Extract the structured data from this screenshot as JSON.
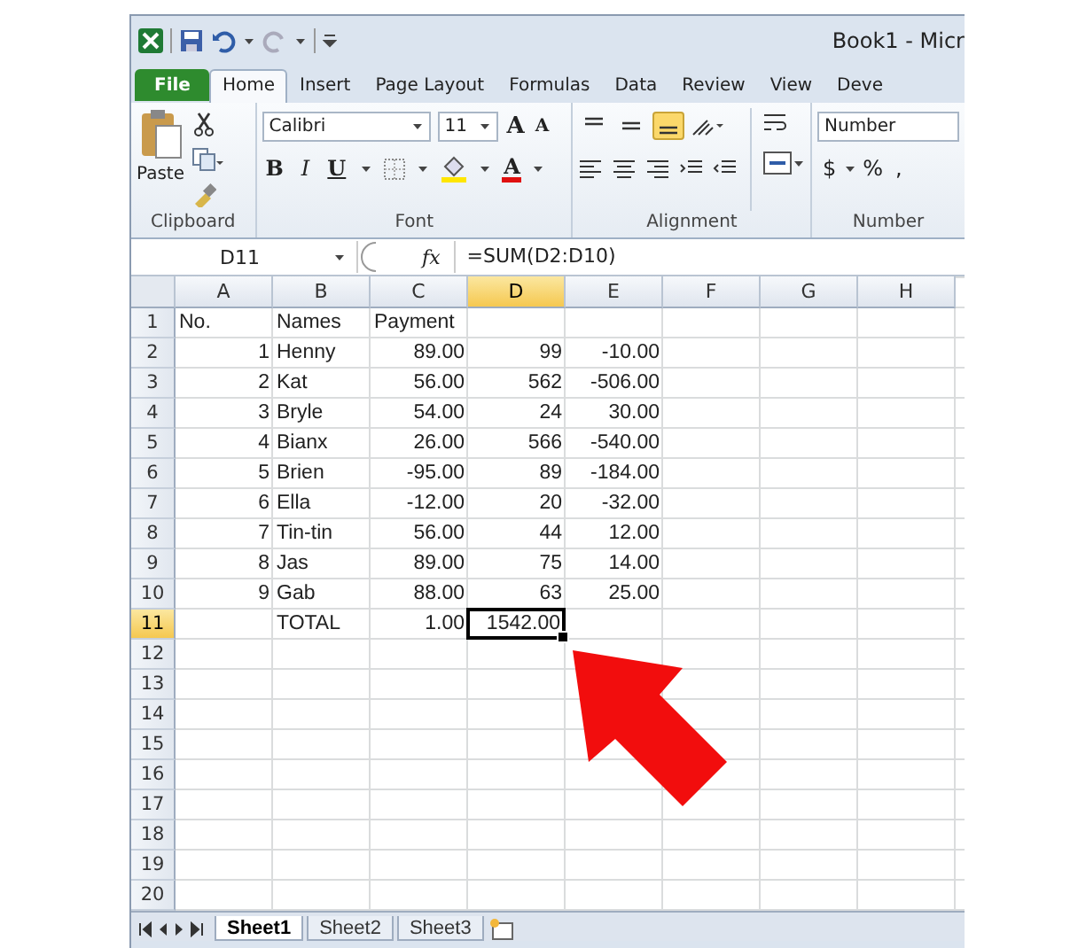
{
  "window": {
    "title": "Book1 - Micr"
  },
  "ribbon_tabs": [
    {
      "label": "File",
      "kind": "file",
      "selected": false
    },
    {
      "label": "Home",
      "kind": "tab",
      "selected": true
    },
    {
      "label": "Insert",
      "kind": "tab",
      "selected": false
    },
    {
      "label": "Page Layout",
      "kind": "tab",
      "selected": false
    },
    {
      "label": "Formulas",
      "kind": "tab",
      "selected": false
    },
    {
      "label": "Data",
      "kind": "tab",
      "selected": false
    },
    {
      "label": "Review",
      "kind": "tab",
      "selected": false
    },
    {
      "label": "View",
      "kind": "tab",
      "selected": false
    },
    {
      "label": "Deve",
      "kind": "tab",
      "selected": false
    }
  ],
  "clipboard": {
    "paste_label": "Paste",
    "group_label": "Clipboard"
  },
  "font": {
    "name": "Calibri",
    "size": "11",
    "grow": "A",
    "shrink": "A",
    "bold": "B",
    "italic": "I",
    "underline": "U",
    "font_color": "A",
    "group_label": "Font"
  },
  "alignment": {
    "vertical": [
      {
        "selected": false
      },
      {
        "selected": false
      },
      {
        "selected": true
      }
    ],
    "group_label": "Alignment"
  },
  "number": {
    "format": "Number",
    "buttons": [
      "$",
      "%",
      ","
    ],
    "group_label": "Number"
  },
  "formula_bar": {
    "name_box": "D11",
    "fx": "fx",
    "formula": "=SUM(D2:D10)"
  },
  "columns": [
    {
      "label": "A",
      "selected": false
    },
    {
      "label": "B",
      "selected": false
    },
    {
      "label": "C",
      "selected": false
    },
    {
      "label": "D",
      "selected": true
    },
    {
      "label": "E",
      "selected": false
    },
    {
      "label": "F",
      "selected": false
    },
    {
      "label": "G",
      "selected": false
    },
    {
      "label": "H",
      "selected": false
    }
  ],
  "rows": [
    {
      "label": "1",
      "selected": false,
      "cells": {
        "A": {
          "text": "No.",
          "kind": "text"
        },
        "B": {
          "text": "Names",
          "kind": "text"
        },
        "C": {
          "text": "Payment",
          "kind": "text"
        }
      }
    },
    {
      "label": "2",
      "selected": false,
      "cells": {
        "A": {
          "text": "1",
          "kind": "number"
        },
        "B": {
          "text": "Henny",
          "kind": "text"
        },
        "C": {
          "text": "89.00",
          "kind": "number"
        },
        "D": {
          "text": "99",
          "kind": "number"
        },
        "E": {
          "text": "-10.00",
          "kind": "number"
        }
      }
    },
    {
      "label": "3",
      "selected": false,
      "cells": {
        "A": {
          "text": "2",
          "kind": "number"
        },
        "B": {
          "text": "Kat",
          "kind": "text"
        },
        "C": {
          "text": "56.00",
          "kind": "number"
        },
        "D": {
          "text": "562",
          "kind": "number"
        },
        "E": {
          "text": "-506.00",
          "kind": "number"
        }
      }
    },
    {
      "label": "4",
      "selected": false,
      "cells": {
        "A": {
          "text": "3",
          "kind": "number"
        },
        "B": {
          "text": "Bryle",
          "kind": "text"
        },
        "C": {
          "text": "54.00",
          "kind": "number"
        },
        "D": {
          "text": "24",
          "kind": "number"
        },
        "E": {
          "text": "30.00",
          "kind": "number"
        }
      }
    },
    {
      "label": "5",
      "selected": false,
      "cells": {
        "A": {
          "text": "4",
          "kind": "number"
        },
        "B": {
          "text": "Bianx",
          "kind": "text"
        },
        "C": {
          "text": "26.00",
          "kind": "number"
        },
        "D": {
          "text": "566",
          "kind": "number"
        },
        "E": {
          "text": "-540.00",
          "kind": "number"
        }
      }
    },
    {
      "label": "6",
      "selected": false,
      "cells": {
        "A": {
          "text": "5",
          "kind": "number"
        },
        "B": {
          "text": "Brien",
          "kind": "text"
        },
        "C": {
          "text": "-95.00",
          "kind": "number"
        },
        "D": {
          "text": "89",
          "kind": "number"
        },
        "E": {
          "text": "-184.00",
          "kind": "number"
        }
      }
    },
    {
      "label": "7",
      "selected": false,
      "cells": {
        "A": {
          "text": "6",
          "kind": "number"
        },
        "B": {
          "text": "Ella",
          "kind": "text"
        },
        "C": {
          "text": "-12.00",
          "kind": "number"
        },
        "D": {
          "text": "20",
          "kind": "number"
        },
        "E": {
          "text": "-32.00",
          "kind": "number"
        }
      }
    },
    {
      "label": "8",
      "selected": false,
      "cells": {
        "A": {
          "text": "7",
          "kind": "number"
        },
        "B": {
          "text": "Tin-tin",
          "kind": "text"
        },
        "C": {
          "text": "56.00",
          "kind": "number"
        },
        "D": {
          "text": "44",
          "kind": "number"
        },
        "E": {
          "text": "12.00",
          "kind": "number"
        }
      }
    },
    {
      "label": "9",
      "selected": false,
      "cells": {
        "A": {
          "text": "8",
          "kind": "number"
        },
        "B": {
          "text": "Jas",
          "kind": "text"
        },
        "C": {
          "text": "89.00",
          "kind": "number"
        },
        "D": {
          "text": "75",
          "kind": "number"
        },
        "E": {
          "text": "14.00",
          "kind": "number"
        }
      }
    },
    {
      "label": "10",
      "selected": false,
      "cells": {
        "A": {
          "text": "9",
          "kind": "number"
        },
        "B": {
          "text": "Gab",
          "kind": "text"
        },
        "C": {
          "text": "88.00",
          "kind": "number"
        },
        "D": {
          "text": "63",
          "kind": "number"
        },
        "E": {
          "text": "25.00",
          "kind": "number"
        }
      }
    },
    {
      "label": "11",
      "selected": true,
      "cells": {
        "B": {
          "text": "TOTAL",
          "kind": "text"
        },
        "C": {
          "text": "1.00",
          "kind": "number"
        },
        "D": {
          "text": "1542.00",
          "kind": "number",
          "selected": true
        }
      }
    },
    {
      "label": "12",
      "selected": false
    },
    {
      "label": "13",
      "selected": false
    },
    {
      "label": "14",
      "selected": false
    },
    {
      "label": "15",
      "selected": false
    },
    {
      "label": "16",
      "selected": false
    },
    {
      "label": "17",
      "selected": false
    },
    {
      "label": "18",
      "selected": false
    },
    {
      "label": "19",
      "selected": false
    },
    {
      "label": "20",
      "selected": false
    }
  ],
  "sheet_tabs": [
    {
      "label": "Sheet1",
      "selected": true
    },
    {
      "label": "Sheet2",
      "selected": false
    },
    {
      "label": "Sheet3",
      "selected": false
    }
  ]
}
